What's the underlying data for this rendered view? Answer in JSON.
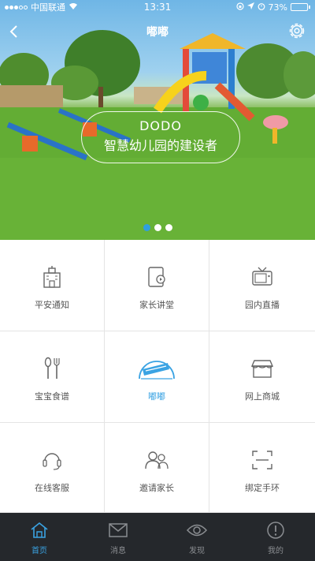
{
  "status_bar": {
    "carrier": "中国联通",
    "time": "13:31",
    "battery_percent": "73%",
    "battery_level": 0.73
  },
  "nav": {
    "title": "嘟嘟"
  },
  "hero": {
    "caption_en": "DODO",
    "caption_zh": "智慧幼儿园的建设者",
    "page_count": 3,
    "active_page": 0
  },
  "grid": [
    {
      "label": "平安通知",
      "icon": "school-building-icon"
    },
    {
      "label": "家长讲堂",
      "icon": "tablet-icon"
    },
    {
      "label": "园内直播",
      "icon": "tv-icon"
    },
    {
      "label": "宝宝食谱",
      "icon": "spoon-fork-icon"
    },
    {
      "label": "嘟嘟",
      "icon": "dodo-logo-icon",
      "active": true
    },
    {
      "label": "网上商城",
      "icon": "shop-icon"
    },
    {
      "label": "在线客服",
      "icon": "headset-icon"
    },
    {
      "label": "邀请家长",
      "icon": "people-icon"
    },
    {
      "label": "绑定手环",
      "icon": "scan-frame-icon"
    }
  ],
  "tabs": [
    {
      "label": "首页",
      "icon": "home-icon",
      "active": true
    },
    {
      "label": "消息",
      "icon": "envelope-icon"
    },
    {
      "label": "发现",
      "icon": "eye-icon"
    },
    {
      "label": "我的",
      "icon": "exclamation-circle-icon"
    }
  ],
  "colors": {
    "accent": "#3aa3e3",
    "tabbar_bg": "#25282c",
    "battery_fill": "#3fd23f"
  }
}
